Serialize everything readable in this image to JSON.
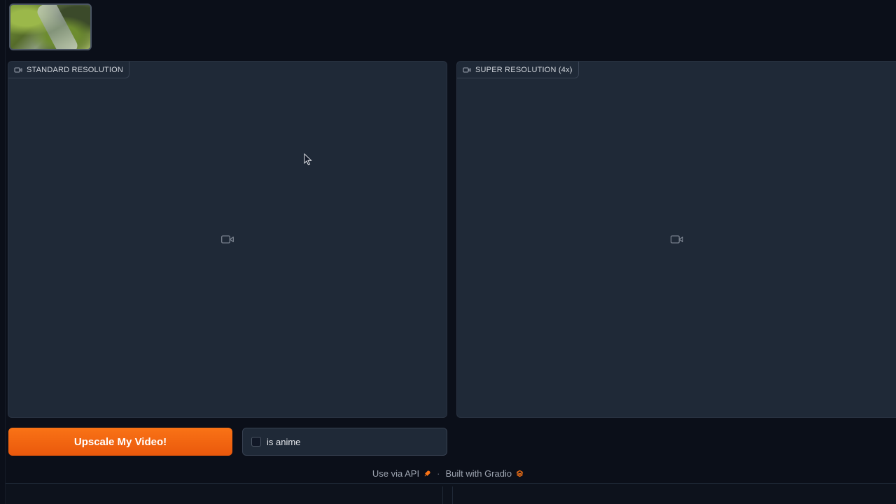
{
  "examples": {
    "thumbnail_alt": "example video thumbnail"
  },
  "input_video": {
    "label": "STANDARD RESOLUTION",
    "icon": "video-camera-icon"
  },
  "output_video": {
    "label": "SUPER RESOLUTION (4x)",
    "icon": "video-camera-icon"
  },
  "actions": {
    "upscale_button": "Upscale My Video!",
    "anime_checkbox_label": "is anime",
    "anime_checked": false
  },
  "footer": {
    "api_link": "Use via API",
    "separator": "·",
    "built_with": "Built with Gradio"
  },
  "colors": {
    "accent": "#f97316",
    "background": "#0b0f19",
    "panel": "#1f2937"
  }
}
